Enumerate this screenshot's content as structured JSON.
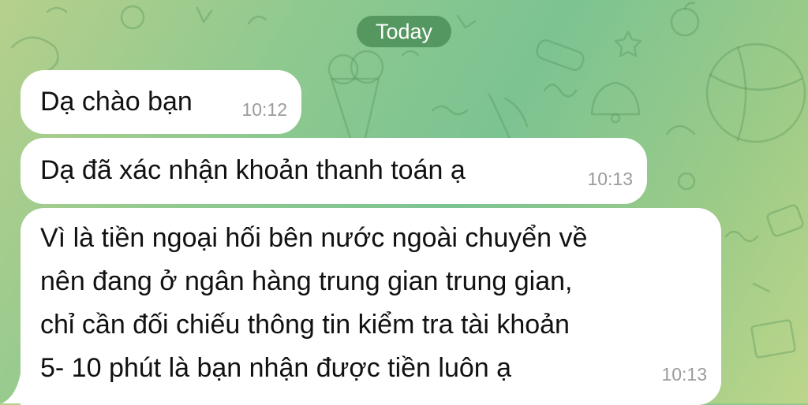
{
  "chat": {
    "date_label": "Today",
    "messages": [
      {
        "text": "Dạ chào bạn",
        "time": "10:12"
      },
      {
        "text": "Dạ đã xác nhận khoản thanh toán ạ",
        "time": "10:13"
      },
      {
        "text": "Vì là tiền ngoại hối bên nước ngoài chuyển về\nnên đang ở ngân hàng trung gian trung gian,\nchỉ cần đối chiếu thông tin kiểm tra tài khoản\n5- 10 phút là bạn nhận được tiền luôn ạ",
        "time": "10:13"
      }
    ]
  },
  "colors": {
    "bubble": "#ffffff",
    "date_pill": "#4a8c56",
    "time_text": "#9b9b9b",
    "wallpaper": "#8fc98f"
  },
  "icons": [
    "wallpaper-doodle-pattern"
  ]
}
